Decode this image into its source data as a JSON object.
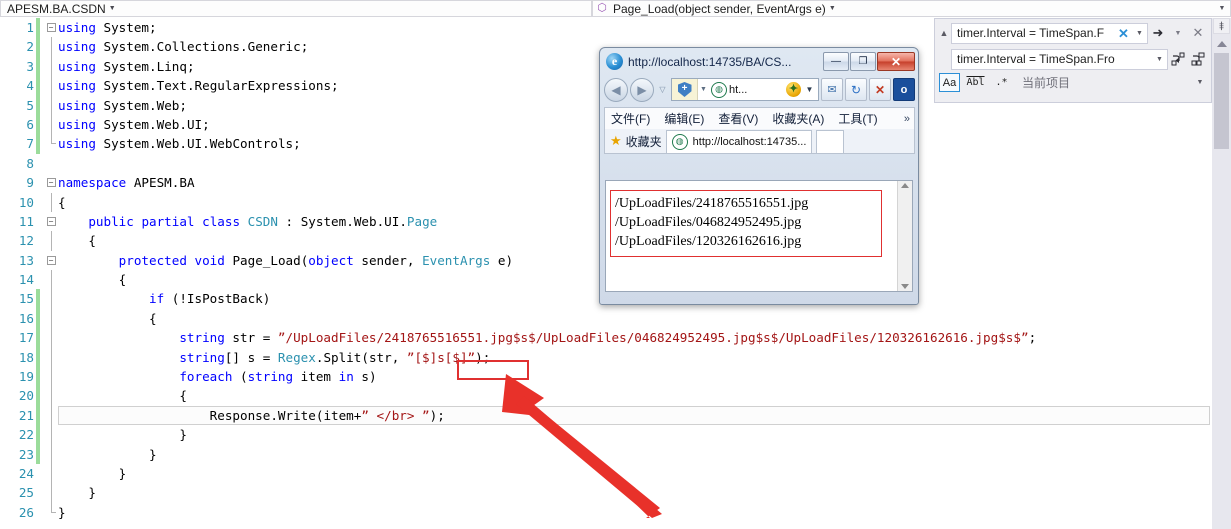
{
  "ide": {
    "class_selector": "APESM.BA.CSDN",
    "member_selector": "Page_Load(object sender, EventArgs e)",
    "member_icon": "method-icon",
    "dropdown_icon": "chevron-down-icon"
  },
  "editor": {
    "lines": [
      {
        "n": "1",
        "changed": true,
        "outline": "minus",
        "text": "using System;"
      },
      {
        "n": "2",
        "changed": true,
        "outline": "line",
        "text": "using System.Collections.Generic;"
      },
      {
        "n": "3",
        "changed": true,
        "outline": "line",
        "text": "using System.Linq;"
      },
      {
        "n": "4",
        "changed": true,
        "outline": "line",
        "text": "using System.Text.RegularExpressions;"
      },
      {
        "n": "5",
        "changed": true,
        "outline": "line",
        "text": "using System.Web;"
      },
      {
        "n": "6",
        "changed": true,
        "outline": "line",
        "text": "using System.Web.UI;"
      },
      {
        "n": "7",
        "changed": true,
        "outline": "end",
        "text": "using System.Web.UI.WebControls;"
      },
      {
        "n": "8",
        "changed": false,
        "outline": "",
        "text": ""
      },
      {
        "n": "9",
        "changed": false,
        "outline": "minus",
        "text": "namespace APESM.BA"
      },
      {
        "n": "10",
        "changed": false,
        "outline": "line",
        "text": "{"
      },
      {
        "n": "11",
        "changed": false,
        "outline": "minus",
        "text": "    public partial class CSDN : System.Web.UI.Page"
      },
      {
        "n": "12",
        "changed": false,
        "outline": "line",
        "text": "    {"
      },
      {
        "n": "13",
        "changed": false,
        "outline": "minus",
        "text": "        protected void Page_Load(object sender, EventArgs e)"
      },
      {
        "n": "14",
        "changed": false,
        "outline": "line",
        "text": "        {"
      },
      {
        "n": "15",
        "changed": true,
        "outline": "line",
        "text": "            if (!IsPostBack)"
      },
      {
        "n": "16",
        "changed": true,
        "outline": "line",
        "text": "            {"
      },
      {
        "n": "17",
        "changed": true,
        "outline": "line",
        "text": "                string str = \"/UpLoadFiles/2418765516551.jpg$s$/UpLoadFiles/046824952495.jpg$s$/UpLoadFiles/120326162616.jpg$s$\";"
      },
      {
        "n": "18",
        "changed": true,
        "outline": "line",
        "text": "                string[] s = Regex.Split(str, \"[$]s[$]\");"
      },
      {
        "n": "19",
        "changed": true,
        "outline": "line",
        "text": "                foreach (string item in s)"
      },
      {
        "n": "20",
        "changed": true,
        "outline": "line",
        "text": "                {"
      },
      {
        "n": "21",
        "changed": true,
        "outline": "line",
        "text": "                    Response.Write(item+\" </br> \");"
      },
      {
        "n": "22",
        "changed": true,
        "outline": "line",
        "text": "                }"
      },
      {
        "n": "23",
        "changed": true,
        "outline": "line",
        "text": "            }"
      },
      {
        "n": "24",
        "changed": false,
        "outline": "line",
        "text": "        }"
      },
      {
        "n": "25",
        "changed": false,
        "outline": "line",
        "text": "    }"
      },
      {
        "n": "26",
        "changed": false,
        "outline": "end",
        "text": "}"
      }
    ],
    "current_line": "21",
    "annotation_color": "#e03030"
  },
  "find_replace": {
    "find_value": "timer.Interval = TimeSpan.F",
    "replace_value": "timer.Interval = TimeSpan.Fro",
    "expander_icon": "chevron-up-icon",
    "clear_icon": "clear-x-icon",
    "find_dropdown_icon": "chevron-down-icon",
    "find_next_icon": "arrow-right-icon",
    "find_next_dropdown_icon": "chevron-down-icon",
    "close_icon": "close-x-icon",
    "replace_dropdown_icon": "chevron-down-icon",
    "replace_next_icon": "replace-next-icon",
    "replace_all_icon": "replace-all-icon",
    "match_case_label": "Aa",
    "match_word_label": "Abl",
    "use_regex_label": ".*",
    "scope_label": "当前项目",
    "scope_caret_icon": "chevron-down-icon"
  },
  "vs_scrollbar": {
    "top_caret_icon": "chevron-down-icon",
    "split_icon": "split-view-icon",
    "up_arrow_icon": "scroll-up-icon"
  },
  "browser": {
    "title": "http://localhost:14735/BA/CS...",
    "logo_icon": "ie-logo-icon",
    "minimize_label": "—",
    "maximize_label": "❐",
    "close_label": "✕",
    "back_icon": "back-arrow-icon",
    "forward_icon": "forward-arrow-icon",
    "history_caret_icon": "chevron-down-icon",
    "shield_icon": "compat-shield-icon",
    "shield_label": "+",
    "shield_caret_icon": "chevron-down-icon",
    "address_globe_icon": "globe-icon",
    "address_text": "ht...",
    "address_pin_icon": "accelerator-icon",
    "address_dropdown_icon": "chevron-down-icon",
    "mail_icon": "mail-page-icon",
    "refresh_icon": "refresh-icon",
    "stop_icon": "stop-x-icon",
    "app_icon": "outlook-app-icon",
    "app_label": "o",
    "menu": [
      "文件(F)",
      "编辑(E)",
      "查看(V)",
      "收藏夹(A)",
      "工具(T)"
    ],
    "menu_overflow_icon": "chevron-double-right-icon",
    "favorites_label": "收藏夹",
    "favorites_star_icon": "star-icon",
    "tab_globe_icon": "globe-icon",
    "tab_title": "http://localhost:14735...",
    "new_tab_icon": "new-tab-icon",
    "page_lines": [
      "/UpLoadFiles/2418765516551.jpg",
      "/UpLoadFiles/046824952495.jpg",
      "/UpLoadFiles/120326162616.jpg"
    ],
    "scroll_up_icon": "scroll-up-icon",
    "scroll_down_icon": "scroll-down-icon"
  }
}
